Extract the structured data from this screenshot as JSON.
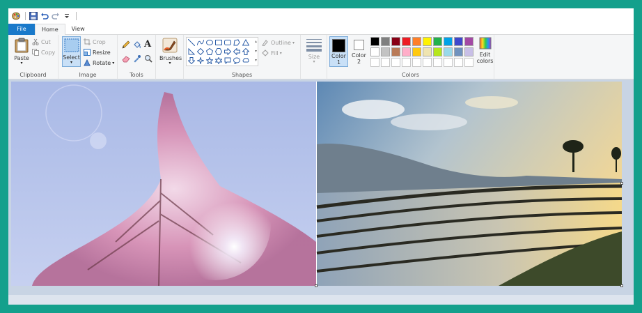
{
  "menu": {
    "tabs": [
      "File",
      "Home",
      "View"
    ]
  },
  "clipboard": {
    "paste": "Paste",
    "cut": "Cut",
    "copy": "Copy",
    "label": "Clipboard"
  },
  "image": {
    "select": "Select",
    "crop": "Crop",
    "resize": "Resize",
    "rotate": "Rotate",
    "label": "Image"
  },
  "tools": {
    "label": "Tools"
  },
  "brushes": {
    "label": "Brushes"
  },
  "shapes": {
    "outline": "Outline",
    "fill": "Fill",
    "label": "Shapes"
  },
  "size": {
    "label": "Size"
  },
  "colors": {
    "color1_line1": "Color",
    "color1_line2": "1",
    "color2_line1": "Color",
    "color2_line2": "2",
    "edit_line1": "Edit",
    "edit_line2": "colors",
    "label": "Colors",
    "color1_value": "#000000",
    "color2_value": "#ffffff",
    "palette_row1": [
      "#000000",
      "#7f7f7f",
      "#880015",
      "#ed1c24",
      "#ff7f27",
      "#fff200",
      "#22b14c",
      "#00a2e8",
      "#3f48cc",
      "#a349a4"
    ],
    "palette_row2": [
      "#ffffff",
      "#c3c3c3",
      "#b97a57",
      "#ffaec9",
      "#ffc90e",
      "#efe4b0",
      "#b5e61d",
      "#99d9ea",
      "#7092be",
      "#c8bfe7"
    ]
  },
  "accent": "#1979ca",
  "frame": "#14a08c"
}
